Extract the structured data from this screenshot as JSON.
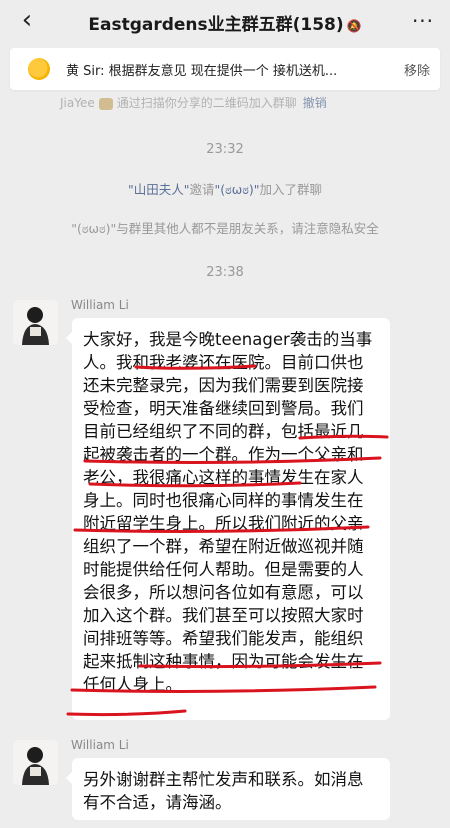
{
  "header": {
    "title": "Eastgardens业主群五群(158)",
    "back_icon": "chevron-left-icon",
    "more_icon": "more-dots-icon"
  },
  "pinned": {
    "text": "黄 Sir: 根据群友意见 现在提供一个 接机送机...",
    "remove_label": "移除"
  },
  "faded_line": {
    "name": "JiaYee",
    "text": "通过扫描你分享的二维码加入群聊",
    "undo": "撤销"
  },
  "messages": {
    "time1": "23:32",
    "sys1_quoted1": "\"山田夫人\"",
    "sys1_mid": "邀请",
    "sys1_quoted2": "\"(ಠωಠ)\"",
    "sys1_end": "加入了群聊",
    "sys2": "\"(ಠωಠ)\"与群里其他人都不是朋友关系，请注意隐私安全",
    "time2": "23:38",
    "sender1": "William Li",
    "msg1": "大家好，我是今晚teenager袭击的当事人。我和我老婆还在医院。目前口供也还未完整录完，因为我们需要到医院接受检查，明天准备继续回到警局。我们目前已经组织了不同的群，包括最近几起被袭击者的一个群。作为一个父亲和老公，我很痛心这样的事情发生在家人身上。同时也很痛心同样的事情发生在附近留学生身上。所以我们附近的父亲组织了一个群，希望在附近做巡视并随时能提供给任何人帮助。但是需要的人会很多，所以想问各位如有意愿，可以加入这个群。我们甚至可以按照大家时间排班等等。希望我们能发声，能组织起来抵制这种事情，因为可能会发生在任何人身上。",
    "sender2": "William Li",
    "msg2": "另外谢谢群主帮忙发声和联系。如消息有不合适，请海涵。"
  },
  "colors": {
    "background": "#ededed",
    "bubble": "#ffffff",
    "annotation_red": "#d9141e",
    "pin_yellow": "#f5b400"
  }
}
